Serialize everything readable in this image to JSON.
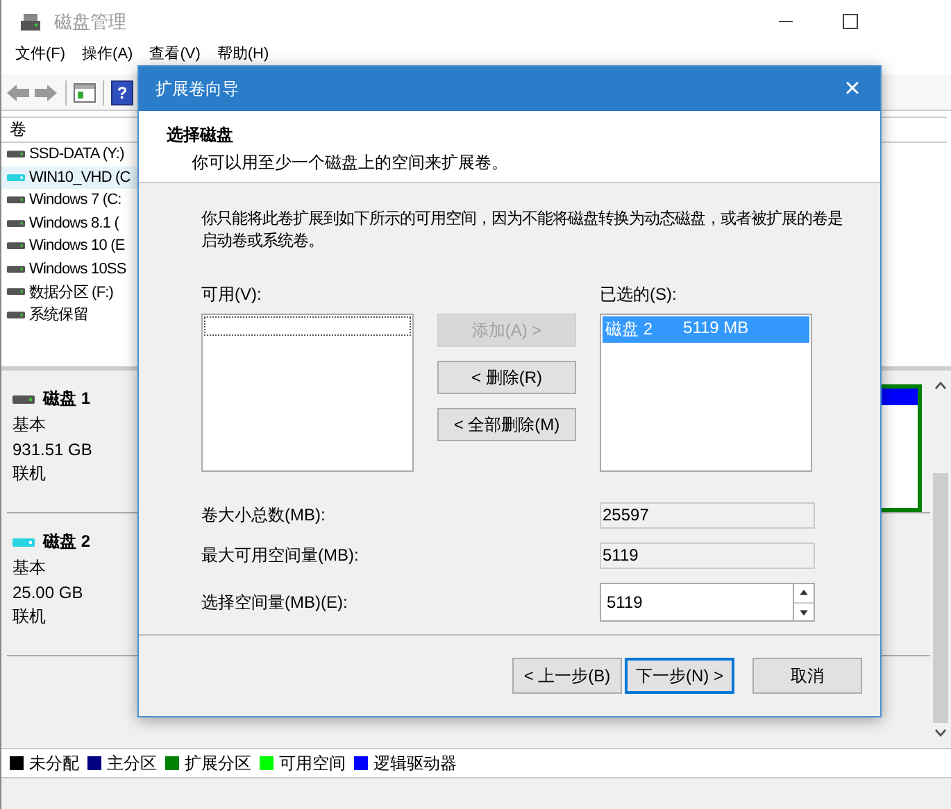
{
  "window": {
    "title": "磁盘管理",
    "menu": [
      "文件(F)",
      "操作(A)",
      "查看(V)",
      "帮助(H)"
    ]
  },
  "toolbar": {
    "help_glyph": "?"
  },
  "volumes": {
    "header": "卷",
    "items": [
      {
        "name": "SSD-DATA (Y:)",
        "selected": false
      },
      {
        "name": "WIN10_VHD (C",
        "selected": true
      },
      {
        "name": "Windows 7 (C:",
        "selected": false
      },
      {
        "name": "Windows 8.1 (",
        "selected": false
      },
      {
        "name": "Windows 10 (E",
        "selected": false
      },
      {
        "name": "Windows 10SS",
        "selected": false
      },
      {
        "name": "数据分区 (F:)",
        "selected": false
      },
      {
        "name": "系统保留",
        "selected": false
      }
    ]
  },
  "disks": [
    {
      "name": "磁盘 1",
      "type": "基本",
      "size": "931.51 GB",
      "status": "联机",
      "selected": false
    },
    {
      "name": "磁盘 2",
      "type": "基本",
      "size": "25.00 GB",
      "status": "联机",
      "selected": true
    }
  ],
  "legend": [
    {
      "label": "未分配",
      "color": "#000000"
    },
    {
      "label": "主分区",
      "color": "#000080"
    },
    {
      "label": "扩展分区",
      "color": "#008000"
    },
    {
      "label": "可用空间",
      "color": "#00ff00"
    },
    {
      "label": "逻辑驱动器",
      "color": "#0000ff"
    }
  ],
  "dialog": {
    "title": "扩展卷向导",
    "close_glyph": "×",
    "heading": "选择磁盘",
    "subheading": "你可以用至少一个磁盘上的空间来扩展卷。",
    "description": "你只能将此卷扩展到如下所示的可用空间，因为不能将磁盘转换为动态磁盘，或者被扩展的卷是启动卷或系统卷。",
    "available_label": "可用(V):",
    "selected_label": "已选的(S):",
    "selected_items": [
      {
        "disk": "磁盘 2",
        "size": "5119 MB",
        "selected": true
      }
    ],
    "move_buttons": [
      {
        "label": "添加(A) >",
        "disabled": true
      },
      {
        "label": "< 删除(R)",
        "disabled": false
      },
      {
        "label": "< 全部删除(M)",
        "disabled": false
      }
    ],
    "fields": [
      {
        "label": "卷大小总数(MB):",
        "value": "25597",
        "kind": "readonly"
      },
      {
        "label": "最大可用空间量(MB):",
        "value": "5119",
        "kind": "readonly"
      },
      {
        "label": "选择空间量(MB)(E):",
        "value": "5119",
        "kind": "spin"
      }
    ],
    "nav_buttons": [
      {
        "label": "< 上一步(B)",
        "default": false
      },
      {
        "label": "下一步(N) >",
        "default": true
      },
      {
        "label": "取消",
        "default": false
      }
    ]
  }
}
